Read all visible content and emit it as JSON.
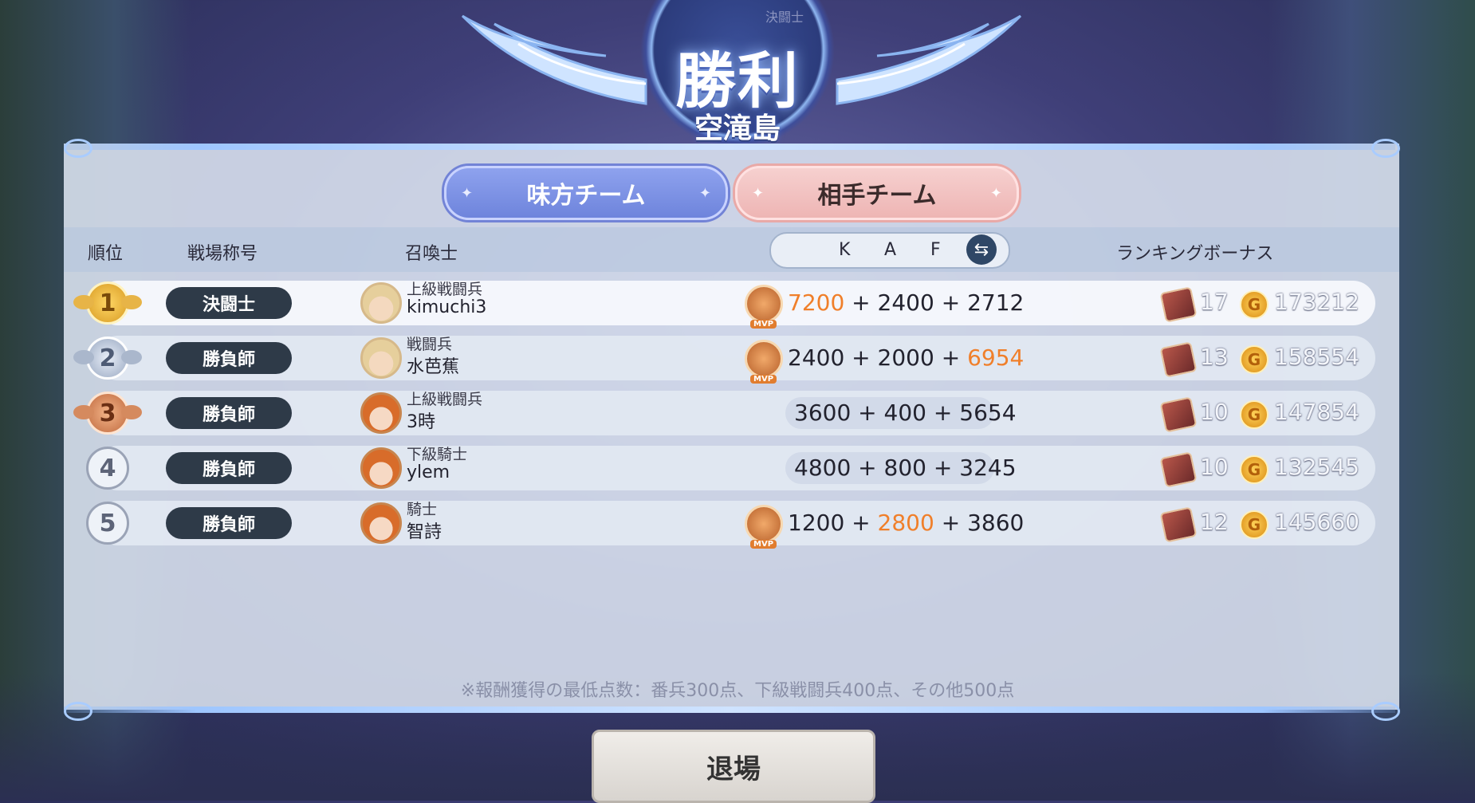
{
  "header": {
    "top_small": "決闘士",
    "title": "勝利",
    "subtitle": "空滝島"
  },
  "tabs": {
    "ally": "味方チーム",
    "enemy": "相手チーム"
  },
  "columns": {
    "rank": "順位",
    "title": "戦場称号",
    "summoner": "召喚士",
    "k": "K",
    "a": "A",
    "f": "F",
    "bonus": "ランキングボーナス"
  },
  "rows": [
    {
      "rank": "1",
      "battle_title": "決闘士",
      "rank_name": "上級戦闘兵",
      "name": "kimuchi3",
      "k": "7200",
      "a": "2400",
      "f": "2712",
      "highlight": "k",
      "mvp": true,
      "chests": "17",
      "coins": "173212"
    },
    {
      "rank": "2",
      "battle_title": "勝負師",
      "rank_name": "戦闘兵",
      "name": "水芭蕉",
      "k": "2400",
      "a": "2000",
      "f": "6954",
      "highlight": "f",
      "mvp": true,
      "chests": "13",
      "coins": "158554"
    },
    {
      "rank": "3",
      "battle_title": "勝負師",
      "rank_name": "上級戦闘兵",
      "name": "3時",
      "k": "3600",
      "a": "400",
      "f": "5654",
      "highlight": "",
      "mvp": false,
      "chests": "10",
      "coins": "147854"
    },
    {
      "rank": "4",
      "battle_title": "勝負師",
      "rank_name": "下級騎士",
      "name": "ylem",
      "k": "4800",
      "a": "800",
      "f": "3245",
      "highlight": "",
      "mvp": false,
      "chests": "10",
      "coins": "132545"
    },
    {
      "rank": "5",
      "battle_title": "勝負師",
      "rank_name": "騎士",
      "name": "智詩",
      "k": "1200",
      "a": "2800",
      "f": "3860",
      "highlight": "a",
      "mvp": true,
      "chests": "12",
      "coins": "145660"
    }
  ],
  "mvp_label": "MVP",
  "plus": "+",
  "coin_glyph": "G",
  "note": "※報酬獲得の最低点数：番兵300点、下級戦闘兵400点、その他500点",
  "exit_label": "退場",
  "colors": {
    "highlight": "#f07f2a",
    "ally_tab": "#7e92e4",
    "enemy_tab": "#f0bcbb"
  }
}
